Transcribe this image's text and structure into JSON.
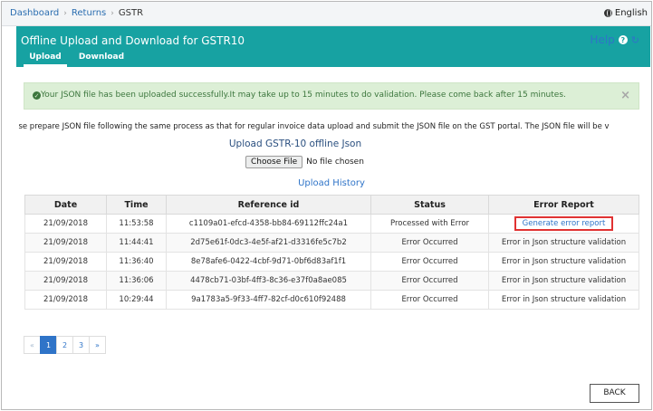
{
  "breadcrumb": {
    "items": [
      "Dashboard",
      "Returns",
      "GSTR"
    ]
  },
  "language": {
    "label": "English"
  },
  "header": {
    "title": "Offline Upload and Download for GSTR10",
    "help_label": "Help",
    "tabs": [
      {
        "label": "Upload",
        "active": true
      },
      {
        "label": "Download",
        "active": false
      }
    ]
  },
  "alert": {
    "message": "Your JSON file has been uploaded successfully.It may take up to 15 minutes to do validation. Please come back after 15 minutes.",
    "close": "×"
  },
  "instruction": "ease prepare JSON file following the same process as that for regular invoice data upload and submit the JSON file on the GST portal. The JSON file will be v",
  "upload": {
    "title": "Upload GSTR-10 offline Json",
    "choose_file": "Choose File",
    "file_status": "No file chosen"
  },
  "history": {
    "title": "Upload History",
    "columns": [
      "Date",
      "Time",
      "Reference id",
      "Status",
      "Error Report"
    ],
    "rows": [
      {
        "date": "21/09/2018",
        "time": "11:53:58",
        "ref": "c1109a01-efcd-4358-bb84-69112ffc24a1",
        "status": "Processed with Error",
        "error": "Generate error report",
        "is_link": true
      },
      {
        "date": "21/09/2018",
        "time": "11:44:41",
        "ref": "2d75e61f-0dc3-4e5f-af21-d3316fe5c7b2",
        "status": "Error Occurred",
        "error": "Error in Json structure validation",
        "is_link": false
      },
      {
        "date": "21/09/2018",
        "time": "11:36:40",
        "ref": "8e78afe6-0422-4cbf-9d71-0bf6d83af1f1",
        "status": "Error Occurred",
        "error": "Error in Json structure validation",
        "is_link": false
      },
      {
        "date": "21/09/2018",
        "time": "11:36:06",
        "ref": "4478cb71-03bf-4ff3-8c36-e37f0a8ae085",
        "status": "Error Occurred",
        "error": "Error in Json structure validation",
        "is_link": false
      },
      {
        "date": "21/09/2018",
        "time": "10:29:44",
        "ref": "9a1783a5-9f33-4ff7-82cf-d0c610f92488",
        "status": "Error Occurred",
        "error": "Error in Json structure validation",
        "is_link": false
      }
    ]
  },
  "pagination": {
    "prev": "«",
    "pages": [
      "1",
      "2",
      "3"
    ],
    "current": "1",
    "next": "»"
  },
  "footer": {
    "back_label": "BACK"
  },
  "colors": {
    "header": "#17a2a2",
    "link": "#2f74c8",
    "alert_bg": "#dcefd6",
    "highlight": "#e03232"
  }
}
